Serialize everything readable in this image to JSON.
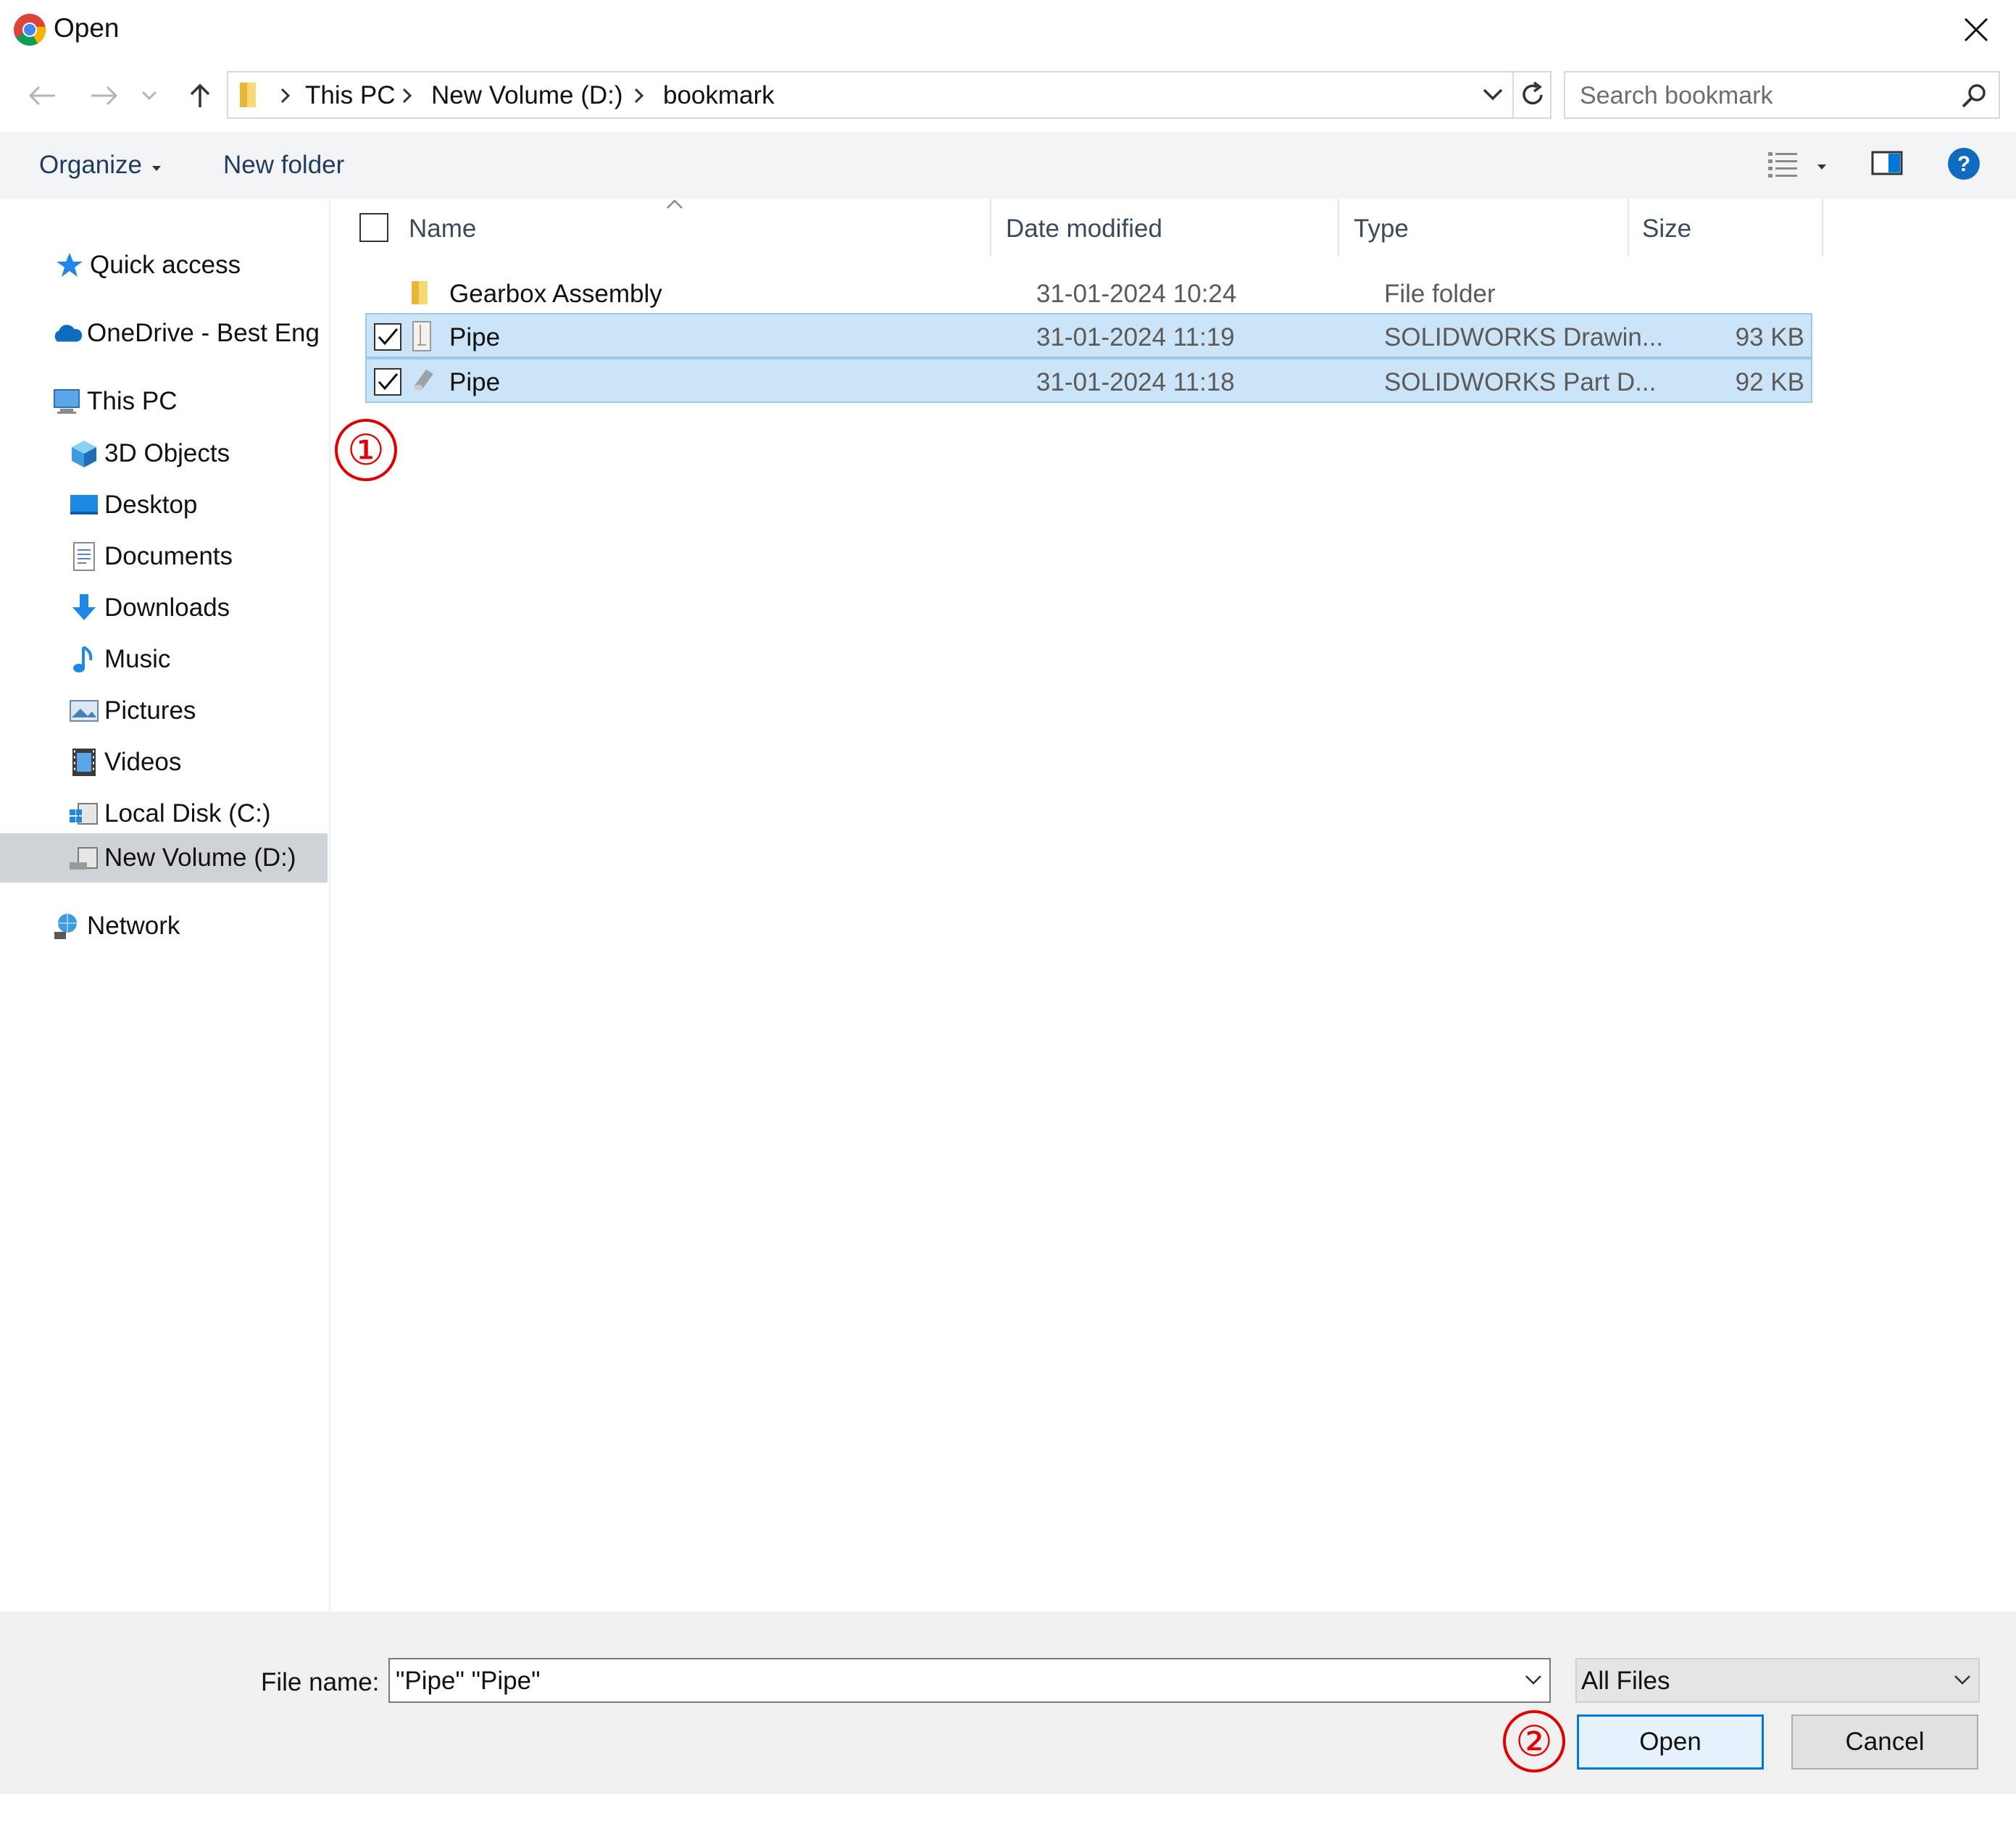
{
  "window": {
    "title": "Open",
    "close_icon": "close-icon"
  },
  "nav": {
    "back_icon": "back-arrow-icon",
    "forward_icon": "forward-arrow-icon",
    "recent_icon": "chevron-down-icon",
    "up_icon": "up-arrow-icon",
    "breadcrumb": [
      "This PC",
      "New Volume (D:)",
      "bookmark"
    ],
    "refresh_icon": "refresh-icon",
    "search_placeholder": "Search bookmark"
  },
  "toolbar": {
    "organize_label": "Organize",
    "new_folder_label": "New folder",
    "view_icon": "details-view-icon",
    "pane_icon": "preview-pane-icon",
    "help_icon": "help-icon"
  },
  "sidebar": {
    "items": [
      {
        "label": "Quick access",
        "icon": "star-icon"
      },
      {
        "label": "OneDrive - Best Eng",
        "icon": "cloud-icon"
      },
      {
        "label": "This PC",
        "icon": "computer-icon"
      },
      {
        "label": "3D Objects",
        "icon": "cube-icon"
      },
      {
        "label": "Desktop",
        "icon": "desktop-icon"
      },
      {
        "label": "Documents",
        "icon": "document-icon"
      },
      {
        "label": "Downloads",
        "icon": "download-icon"
      },
      {
        "label": "Music",
        "icon": "music-icon"
      },
      {
        "label": "Pictures",
        "icon": "pictures-icon"
      },
      {
        "label": "Videos",
        "icon": "video-icon"
      },
      {
        "label": "Local Disk (C:)",
        "icon": "drive-icon"
      },
      {
        "label": "New Volume (D:)",
        "icon": "drive-icon",
        "selected": true
      },
      {
        "label": "Network",
        "icon": "network-icon"
      }
    ]
  },
  "filelist": {
    "columns": [
      "Name",
      "Date modified",
      "Type",
      "Size"
    ],
    "rows": [
      {
        "name": "Gearbox Assembly",
        "date": "31-01-2024 10:24",
        "type": "File folder",
        "size": "",
        "icon": "folder-icon",
        "selected": false
      },
      {
        "name": "Pipe",
        "date": "31-01-2024 11:19",
        "type": "SOLIDWORKS Drawin...",
        "size": "93 KB",
        "icon": "solidworks-drawing-icon",
        "selected": true
      },
      {
        "name": "Pipe",
        "date": "31-01-2024 11:18",
        "type": "SOLIDWORKS Part D...",
        "size": "92 KB",
        "icon": "solidworks-part-icon",
        "selected": true
      }
    ]
  },
  "bottom": {
    "file_name_label": "File name:",
    "file_name_value": "\"Pipe\" \"Pipe\"",
    "file_type_value": "All Files",
    "open_label": "Open",
    "cancel_label": "Cancel"
  },
  "annotations": {
    "step1": "①",
    "step2": "②"
  },
  "colors": {
    "selection_bg": "#cce4f7",
    "selection_border": "#99c9ef",
    "annotation_red": "#e00000",
    "accent_blue": "#0078d7"
  }
}
